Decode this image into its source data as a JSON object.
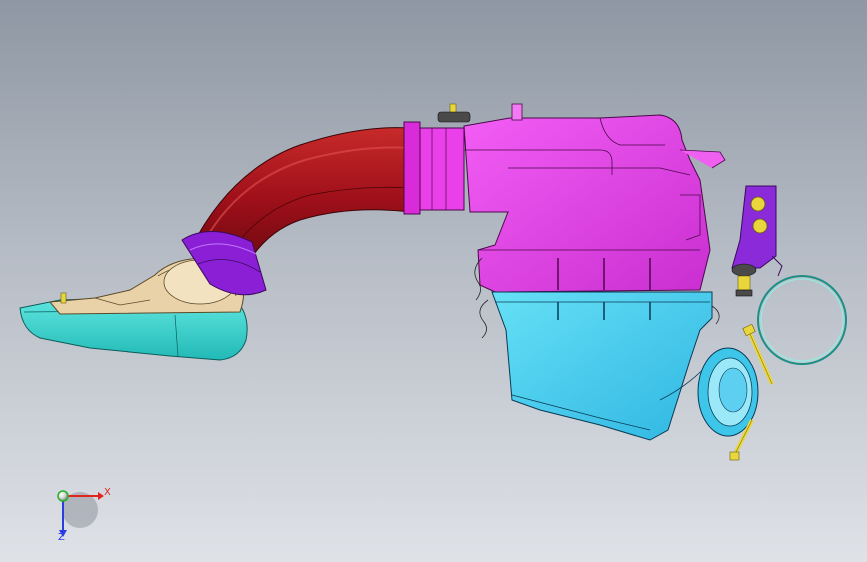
{
  "viewport": {
    "background_top": "#8e97a3",
    "background_bottom": "#dfe2e7"
  },
  "model": {
    "colors": {
      "duct": "#b3121a",
      "coupler": "#8a1fd6",
      "housing_upper": "#ee3bf0",
      "housing_lower": "#4fd6f2",
      "inlet_scoop": "#3fd7d2",
      "inlet_throat": "#e9d2a8",
      "bracket": "#8a2ad8",
      "fastener": "#e8d63a",
      "clamp": "#1d8f86"
    }
  },
  "triad": {
    "x_label": "X",
    "z_label": "Z",
    "x_color": "#e0261f",
    "y_color": "#25b32a",
    "z_color": "#2a3ee0"
  }
}
